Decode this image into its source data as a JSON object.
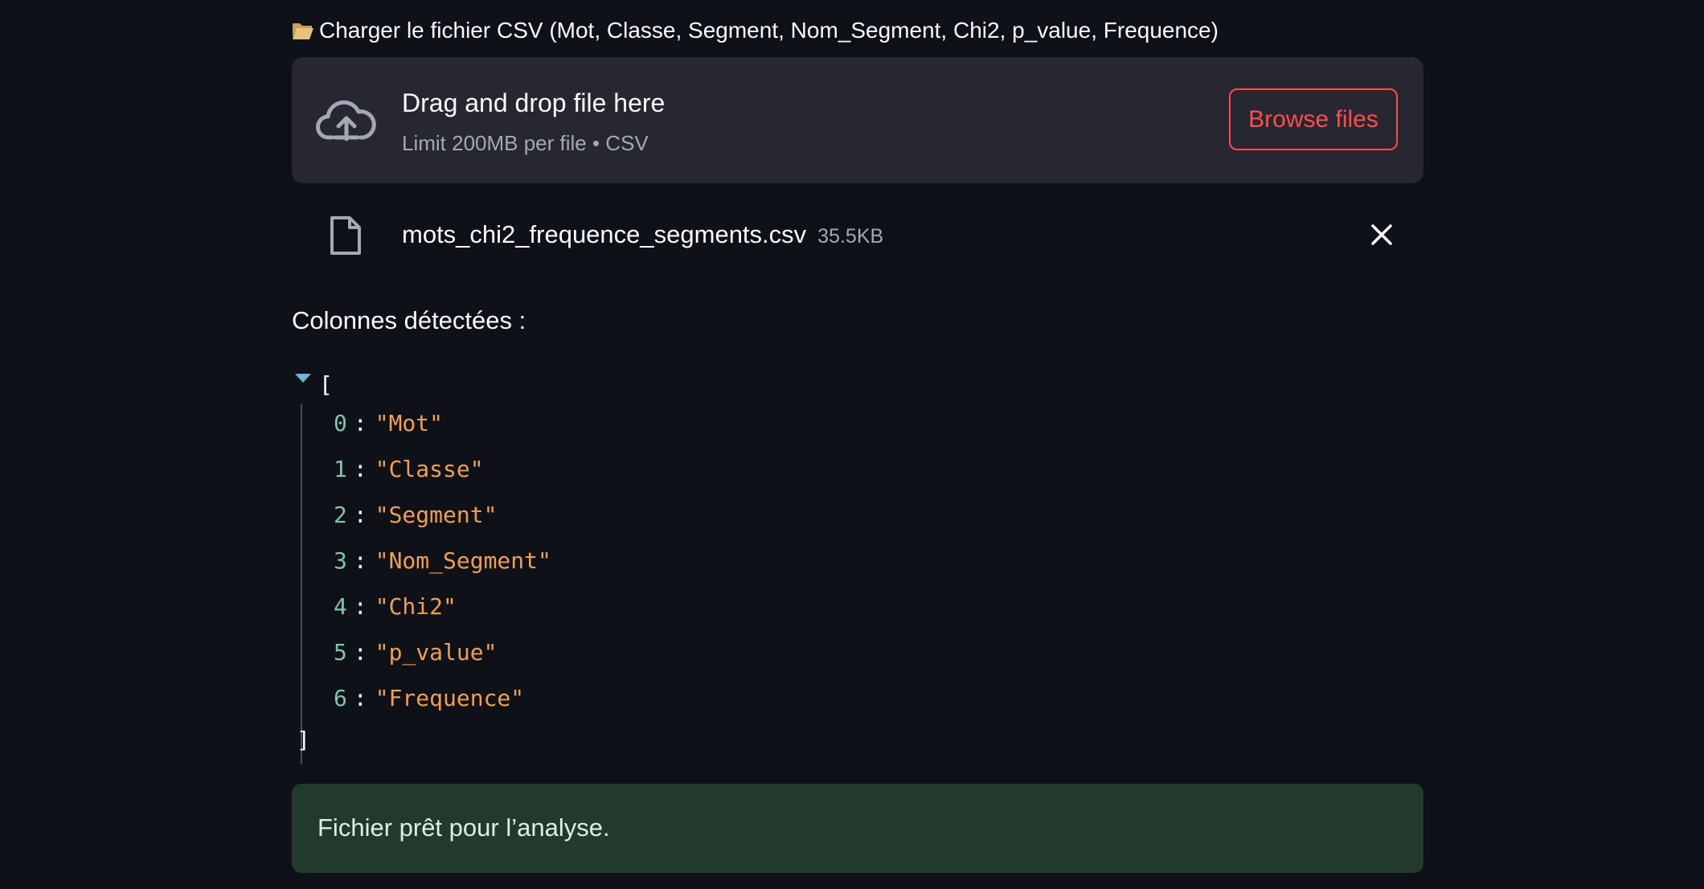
{
  "uploader": {
    "label_icon": "open-folder-icon",
    "label": "Charger le fichier CSV (Mot, Classe, Segment, Nom_Segment, Chi2, p_value, Frequence)",
    "dropzone_title": "Drag and drop file here",
    "dropzone_subtitle": "Limit 200MB per file • CSV",
    "browse_label": "Browse files",
    "upload_icon": "cloud-upload-icon"
  },
  "uploaded_file": {
    "icon": "file-icon",
    "name": "mots_chi2_frequence_segments.csv",
    "size": "35.5KB"
  },
  "columns_section": {
    "label": "Colonnes détectées :",
    "bracket_open": "[",
    "bracket_close": "]",
    "items": [
      {
        "index": "0",
        "value": "\"Mot\""
      },
      {
        "index": "1",
        "value": "\"Classe\""
      },
      {
        "index": "2",
        "value": "\"Segment\""
      },
      {
        "index": "3",
        "value": "\"Nom_Segment\""
      },
      {
        "index": "4",
        "value": "\"Chi2\""
      },
      {
        "index": "5",
        "value": "\"p_value\""
      },
      {
        "index": "6",
        "value": "\"Frequence\""
      }
    ]
  },
  "status": {
    "message": "Fichier prêt pour l’analyse."
  },
  "colors": {
    "background": "#0e1117",
    "dropzone": "#262730",
    "accent": "#ff4b4b",
    "success_bg": "#223a2c",
    "json_index": "#80c4ac",
    "json_value": "#f0a04b"
  }
}
